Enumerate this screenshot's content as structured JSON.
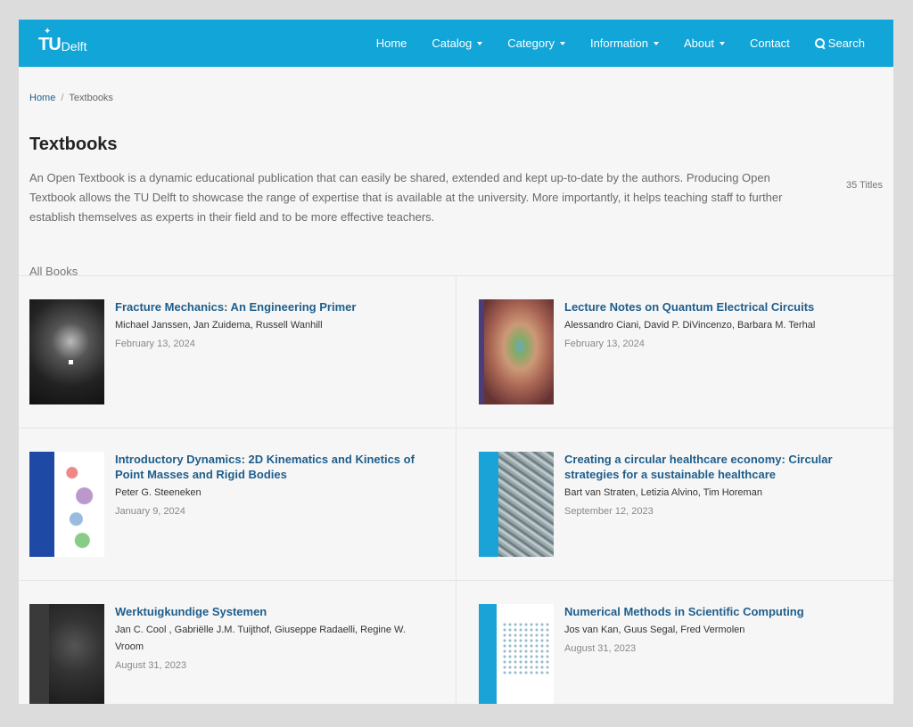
{
  "header": {
    "logo_tu": "TU",
    "logo_delft": "Delft",
    "nav": [
      {
        "label": "Home",
        "dropdown": false
      },
      {
        "label": "Catalog",
        "dropdown": true
      },
      {
        "label": "Category",
        "dropdown": true
      },
      {
        "label": "Information",
        "dropdown": true
      },
      {
        "label": "About",
        "dropdown": true
      },
      {
        "label": "Contact",
        "dropdown": false
      }
    ],
    "search_label": "Search"
  },
  "breadcrumb": {
    "home": "Home",
    "separator": "/",
    "current": "Textbooks"
  },
  "page": {
    "title": "Textbooks",
    "intro": "An Open Textbook is a dynamic educational publication that can easily be shared, extended and kept up-to-date by the authors. Producing Open Textbook allows the TU Delft to showcase the range of expertise that is available at the university. More importantly, it helps teaching staff to further establish themselves as experts in their field and to be more effective teachers.",
    "count": "35 Titles",
    "section_label": "All Books"
  },
  "books": [
    {
      "title": "Fracture Mechanics: An Engineering Primer",
      "authors": "Michael Janssen, Jan Zuidema, Russell Wanhill",
      "date": "February 13, 2024"
    },
    {
      "title": "Lecture Notes on Quantum Electrical Circuits",
      "authors": "Alessandro Ciani, David P. DiVincenzo, Barbara M. Terhal",
      "date": "February 13, 2024"
    },
    {
      "title": "Introductory Dynamics: 2D Kinematics and Kinetics of Point Masses and Rigid Bodies",
      "authors": "Peter G. Steeneken",
      "date": "January 9, 2024"
    },
    {
      "title": "Creating a circular healthcare economy: Circular strategies for a sustainable healthcare",
      "authors": "Bart van Straten, Letizia Alvino, Tim Horeman",
      "date": "September 12, 2023"
    },
    {
      "title": "Werktuigkundige Systemen",
      "authors": "Jan C. Cool , Gabriëlle J.M. Tuijthof, Giuseppe Radaelli, Regine W. Vroom",
      "date": "August 31, 2023"
    },
    {
      "title": "Numerical Methods in Scientific Computing",
      "authors": "Jos van Kan, Guus Segal, Fred Vermolen",
      "date": "August 31, 2023"
    }
  ],
  "colors": {
    "header_bg": "#12a5d8",
    "link": "#1f5e8c",
    "page_bg": "#f6f6f6"
  }
}
